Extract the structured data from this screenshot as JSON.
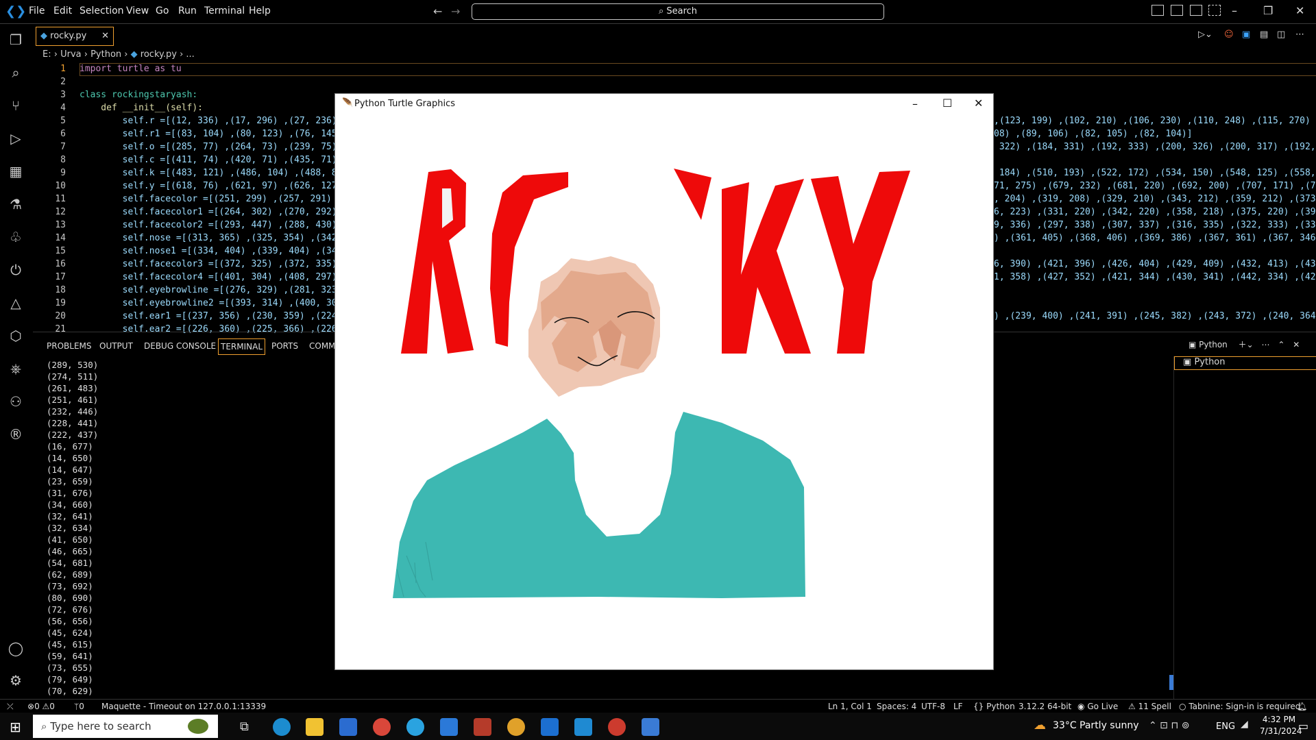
{
  "menubar": {
    "items": [
      "File",
      "Edit",
      "Selection",
      "View",
      "Go",
      "Run",
      "Terminal",
      "Help"
    ],
    "search_label": "Search"
  },
  "tab": {
    "label": "rocky.py"
  },
  "breadcrumb": {
    "parts": [
      "E:",
      "Urva",
      "Python",
      "rocky.py",
      "..."
    ]
  },
  "editor": {
    "lines": [
      {
        "num": "1",
        "code": "import turtle as tu"
      },
      {
        "num": "2",
        "code": ""
      },
      {
        "num": "3",
        "code": "class rockingstaryash:"
      },
      {
        "num": "4",
        "code": "    def __init__(self):"
      },
      {
        "num": "5",
        "code": "        self.r =[(12, 336) ,(17, 296) ,(27, 236)"
      },
      {
        "num": "6",
        "code": "        self.r1 =[(83, 104) ,(80, 123) ,(76, 145"
      },
      {
        "num": "7",
        "code": "        self.o =[(285, 77) ,(264, 73) ,(239, 75)"
      },
      {
        "num": "8",
        "code": "        self.c =[(411, 74) ,(420, 71) ,(435, 71)"
      },
      {
        "num": "9",
        "code": "        self.k =[(483, 121) ,(486, 104) ,(488, 8"
      },
      {
        "num": "10",
        "code": "        self.y =[(618, 76) ,(621, 97) ,(626, 127"
      },
      {
        "num": "11",
        "code": "        self.facecolor =[(251, 299) ,(257, 291)"
      },
      {
        "num": "12",
        "code": "        self.facecolor1 =[(264, 302) ,(270, 292)"
      },
      {
        "num": "13",
        "code": "        self.facecolor2 =[(293, 447) ,(288, 430)"
      },
      {
        "num": "14",
        "code": "        self.nose =[(313, 365) ,(325, 354) ,(342"
      },
      {
        "num": "15",
        "code": "        self.nose1 =[(334, 404) ,(339, 404) ,(34"
      },
      {
        "num": "16",
        "code": "        self.facecolor3 =[(372, 325) ,(372, 335)"
      },
      {
        "num": "17",
        "code": "        self.facecolor4 =[(401, 304) ,(408, 297)"
      },
      {
        "num": "18",
        "code": "        self.eyebrowline =[(276, 329) ,(281, 323"
      },
      {
        "num": "19",
        "code": "        self.eyebrowline2 =[(393, 314) ,(400, 30"
      },
      {
        "num": "20",
        "code": "        self.ear1 =[(237, 356) ,(230, 359) ,(224"
      },
      {
        "num": "21",
        "code": "        self.ear2 =[(226, 360) ,(225, 366) ,(226"
      }
    ],
    "right_lines": [
      {
        "num": "5",
        "code": ",(123, 199) ,(102, 210) ,(106, 230) ,(110, 248) ,(115, 270)"
      },
      {
        "num": "6",
        "code": "08) ,(89, 106) ,(82, 105) ,(82, 104)]"
      },
      {
        "num": "7",
        "code": " 322) ,(184, 331) ,(192, 333) ,(200, 326) ,(200, 317) ,(192,"
      },
      {
        "num": "9",
        "code": " 184) ,(510, 193) ,(522, 172) ,(534, 150) ,(548, 125) ,(558,"
      },
      {
        "num": "10",
        "code": "71, 275) ,(679, 232) ,(681, 220) ,(692, 200) ,(707, 171) ,(72"
      },
      {
        "num": "11",
        "code": ", 204) ,(319, 208) ,(329, 210) ,(343, 212) ,(359, 212) ,(373,"
      },
      {
        "num": "12",
        "code": "6, 223) ,(331, 220) ,(342, 220) ,(358, 218) ,(375, 220) ,(391"
      },
      {
        "num": "13",
        "code": "9, 336) ,(297, 338) ,(307, 337) ,(316, 335) ,(322, 333) ,(332"
      },
      {
        "num": "14",
        "code": ") ,(361, 405) ,(368, 406) ,(369, 386) ,(367, 361) ,(367, 346)"
      },
      {
        "num": "16",
        "code": "6, 390) ,(421, 396) ,(426, 404) ,(429, 409) ,(432, 413) ,(439"
      },
      {
        "num": "17",
        "code": "1, 358) ,(427, 352) ,(421, 344) ,(430, 341) ,(442, 334) ,(429"
      },
      {
        "num": "20",
        "code": ") ,(239, 400) ,(241, 391) ,(245, 382) ,(243, 372) ,(240, 364)"
      }
    ]
  },
  "panel": {
    "tabs": [
      "PROBLEMS",
      "OUTPUT",
      "DEBUG CONSOLE",
      "TERMINAL",
      "PORTS",
      "COMM"
    ],
    "terminal_output": [
      "(289, 530)",
      "(274, 511)",
      "(261, 483)",
      "(251, 461)",
      "(232, 446)",
      "(228, 441)",
      "(222, 437)",
      "(16, 677)",
      "(14, 650)",
      "(14, 647)",
      "(23, 659)",
      "(31, 676)",
      "(34, 660)",
      "(32, 641)",
      "(32, 634)",
      "(41, 650)",
      "(46, 665)",
      "(54, 681)",
      "(62, 689)",
      "(73, 692)",
      "(80, 690)",
      "(72, 676)",
      "(56, 656)",
      "(45, 624)",
      "(45, 615)",
      "(59, 641)",
      "(73, 655)",
      "(79, 649)",
      "(70, 629)"
    ],
    "terminal_name": "Python",
    "terminal_list_item": "Python"
  },
  "turtle_window": {
    "title": "Python Turtle Graphics",
    "logo_text": "ROCKY"
  },
  "statusbar": {
    "errors": "0",
    "warnings": "0",
    "ports": "0",
    "maquette": "Maquette - Timeout on 127.0.0.1:13339",
    "position": "Ln 1, Col 1",
    "spaces": "Spaces: 4",
    "encoding": "UTF-8",
    "eol": "LF",
    "language": "Python",
    "interpreter": "3.12.2 64-bit",
    "golive": "Go Live",
    "spell": "11 Spell",
    "tabnine": "Tabnine: Sign-in is required"
  },
  "taskbar": {
    "search_placeholder": "Type here to search",
    "weather": "33°C  Partly sunny",
    "language": "ENG",
    "time": "4:32 PM",
    "date": "7/31/2024"
  },
  "colors": {
    "accent_border": "#f0a030",
    "rocky_red": "#ee0a0a",
    "shirt_teal": "#3db8b2",
    "skin_light": "#efc7b3",
    "skin_dark": "#e3a98c"
  }
}
